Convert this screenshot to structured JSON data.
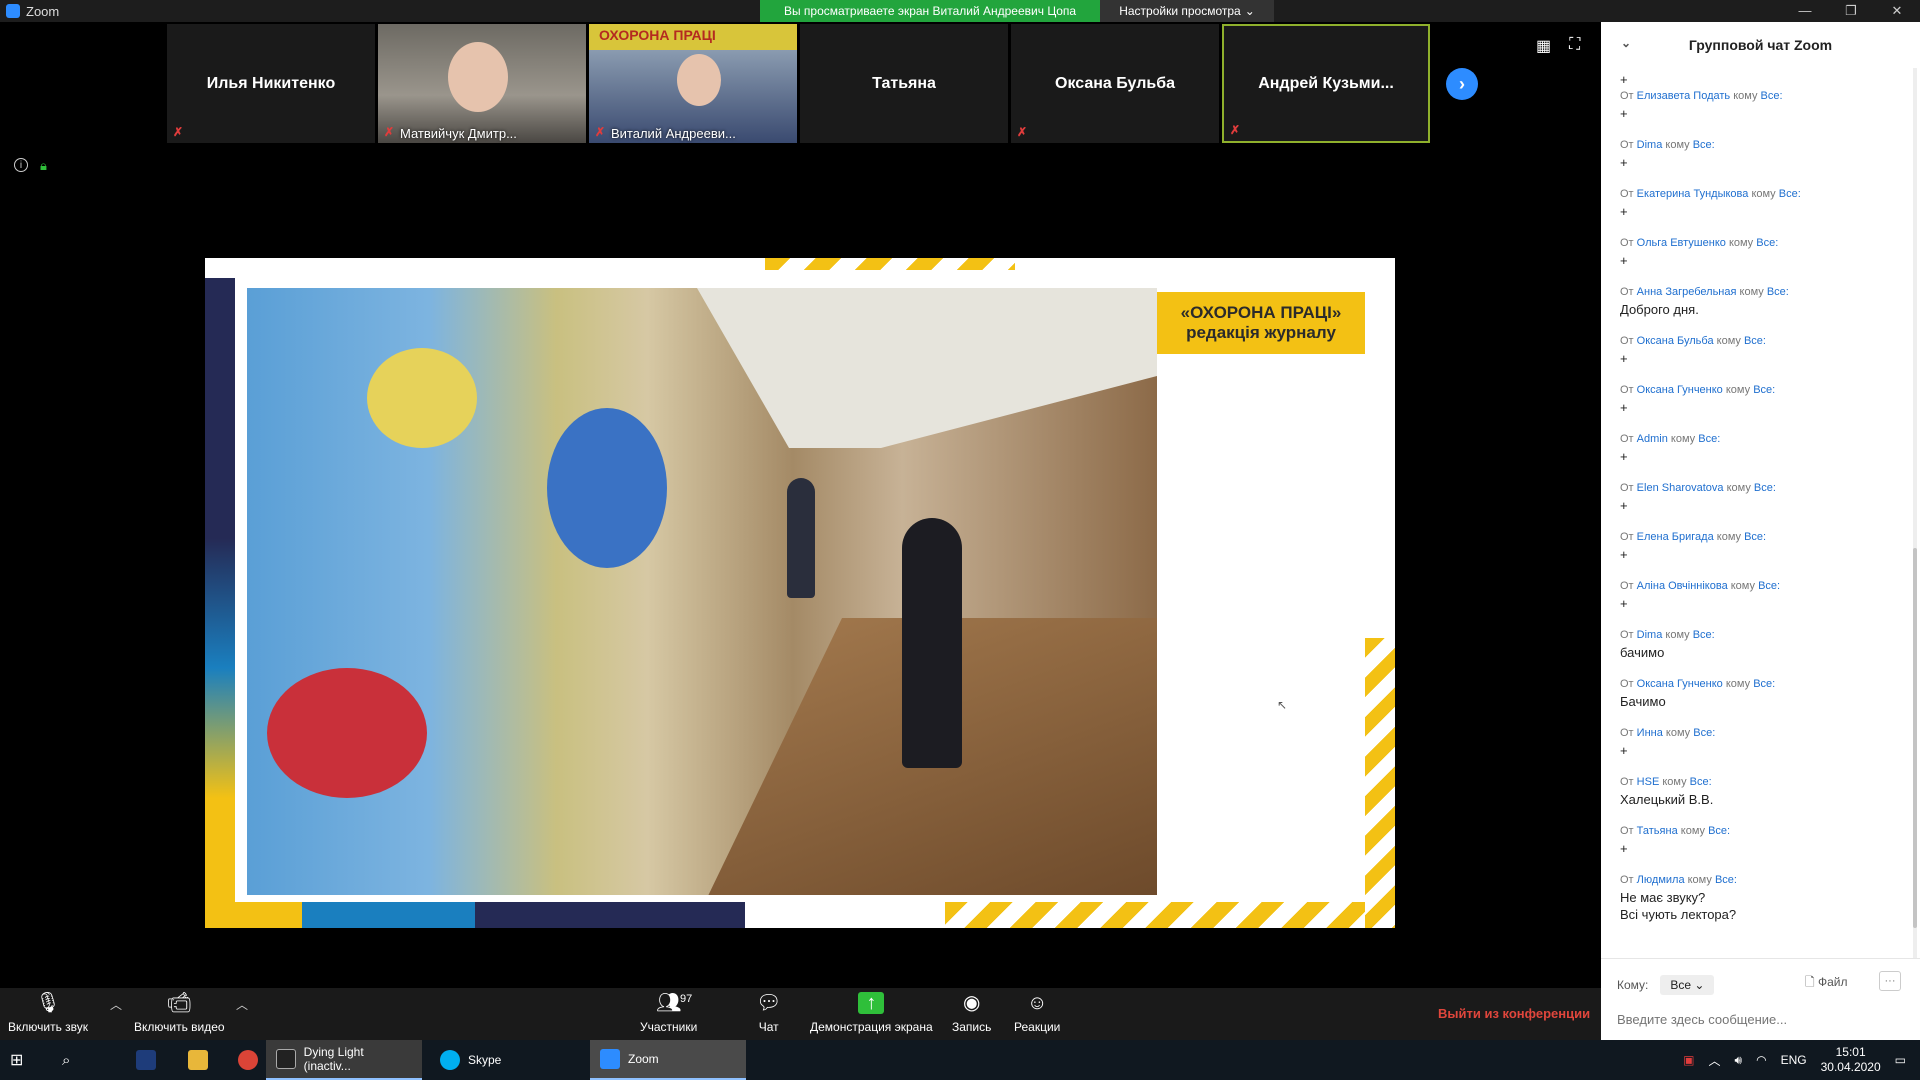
{
  "window": {
    "title": "Zoom"
  },
  "banner": {
    "viewing": "Вы просматриваете экран Виталий Андреевич Цопа",
    "view_options": "Настройки просмотра"
  },
  "participants": [
    {
      "name": "Илья Никитенко"
    },
    {
      "name": "Матвийчук Дмитр..."
    },
    {
      "name": "Виталий Андрееви..."
    },
    {
      "name": "Татьяна"
    },
    {
      "name": "Оксана Бульба"
    },
    {
      "name": "Андрей  Кузьми..."
    }
  ],
  "slide": {
    "label_line1": "«ОХОРОНА ПРАЦІ»",
    "label_line2": "редакція журналу",
    "magazine": "ОХОРОНА ПРАЦІ"
  },
  "chat": {
    "title": "Групповой чат Zoom",
    "messages": [
      {
        "from": "Елизавета Подать",
        "to": "Все:",
        "text": "+"
      },
      {
        "from": "Dima",
        "to": "Все:",
        "text": "+"
      },
      {
        "from": "Екатерина Тундыкова",
        "to": "Все:",
        "text": "+"
      },
      {
        "from": "Ольга Евтушенко",
        "to": "Все:",
        "text": "+"
      },
      {
        "from": "Анна Загребельная",
        "to": "Все:",
        "text": "Доброго дня."
      },
      {
        "from": "Оксана Бульба",
        "to": "Все:",
        "text": "+"
      },
      {
        "from": "Оксана Гунченко",
        "to": "Все:",
        "text": "+"
      },
      {
        "from": "Admin",
        "to": "Все:",
        "text": "+"
      },
      {
        "from": "Elen Sharovatova",
        "to": "Все:",
        "text": "+"
      },
      {
        "from": "Елена Бригада",
        "to": "Все:",
        "text": "+"
      },
      {
        "from": "Аліна Овчіннікова",
        "to": "Все:",
        "text": "+"
      },
      {
        "from": "Dima",
        "to": "Все:",
        "text": "бачимо"
      },
      {
        "from": "Оксана Гунченко",
        "to": "Все:",
        "text": "Бачимо"
      },
      {
        "from": "Инна",
        "to": "Все:",
        "text": "+"
      },
      {
        "from": "HSE",
        "to": "Все:",
        "text": "Халецький В.В."
      },
      {
        "from": "Татьяна",
        "to": "Все:",
        "text": "+"
      },
      {
        "from": "Людмила",
        "to": "Все:",
        "text": "Не має звуку?",
        "text2": "Всі чують лектора?"
      }
    ],
    "from_word": "От",
    "to_word": "кому",
    "recipient_label": "Кому:",
    "recipient_value": "Все",
    "file_label": "Файл",
    "input_placeholder": "Введите здесь сообщение..."
  },
  "toolbar": {
    "unmute": "Включить звук",
    "start_video": "Включить видео",
    "participants": "Участники",
    "participants_count": "97",
    "chat": "Чат",
    "share": "Демонстрация экрана",
    "record": "Запись",
    "reactions": "Реакции",
    "leave": "Выйти из конференции"
  },
  "taskbar": {
    "apps": [
      {
        "label": "Dying Light (inactiv..."
      },
      {
        "label": "Skype"
      },
      {
        "label": "Zoom"
      }
    ],
    "lang": "ENG",
    "time": "15:01",
    "date": "30.04.2020"
  },
  "colors": {
    "accent": "#2d8cff",
    "banner_green": "#22a53d",
    "leave_red": "#e0463c",
    "slide_yellow": "#f3c114"
  }
}
